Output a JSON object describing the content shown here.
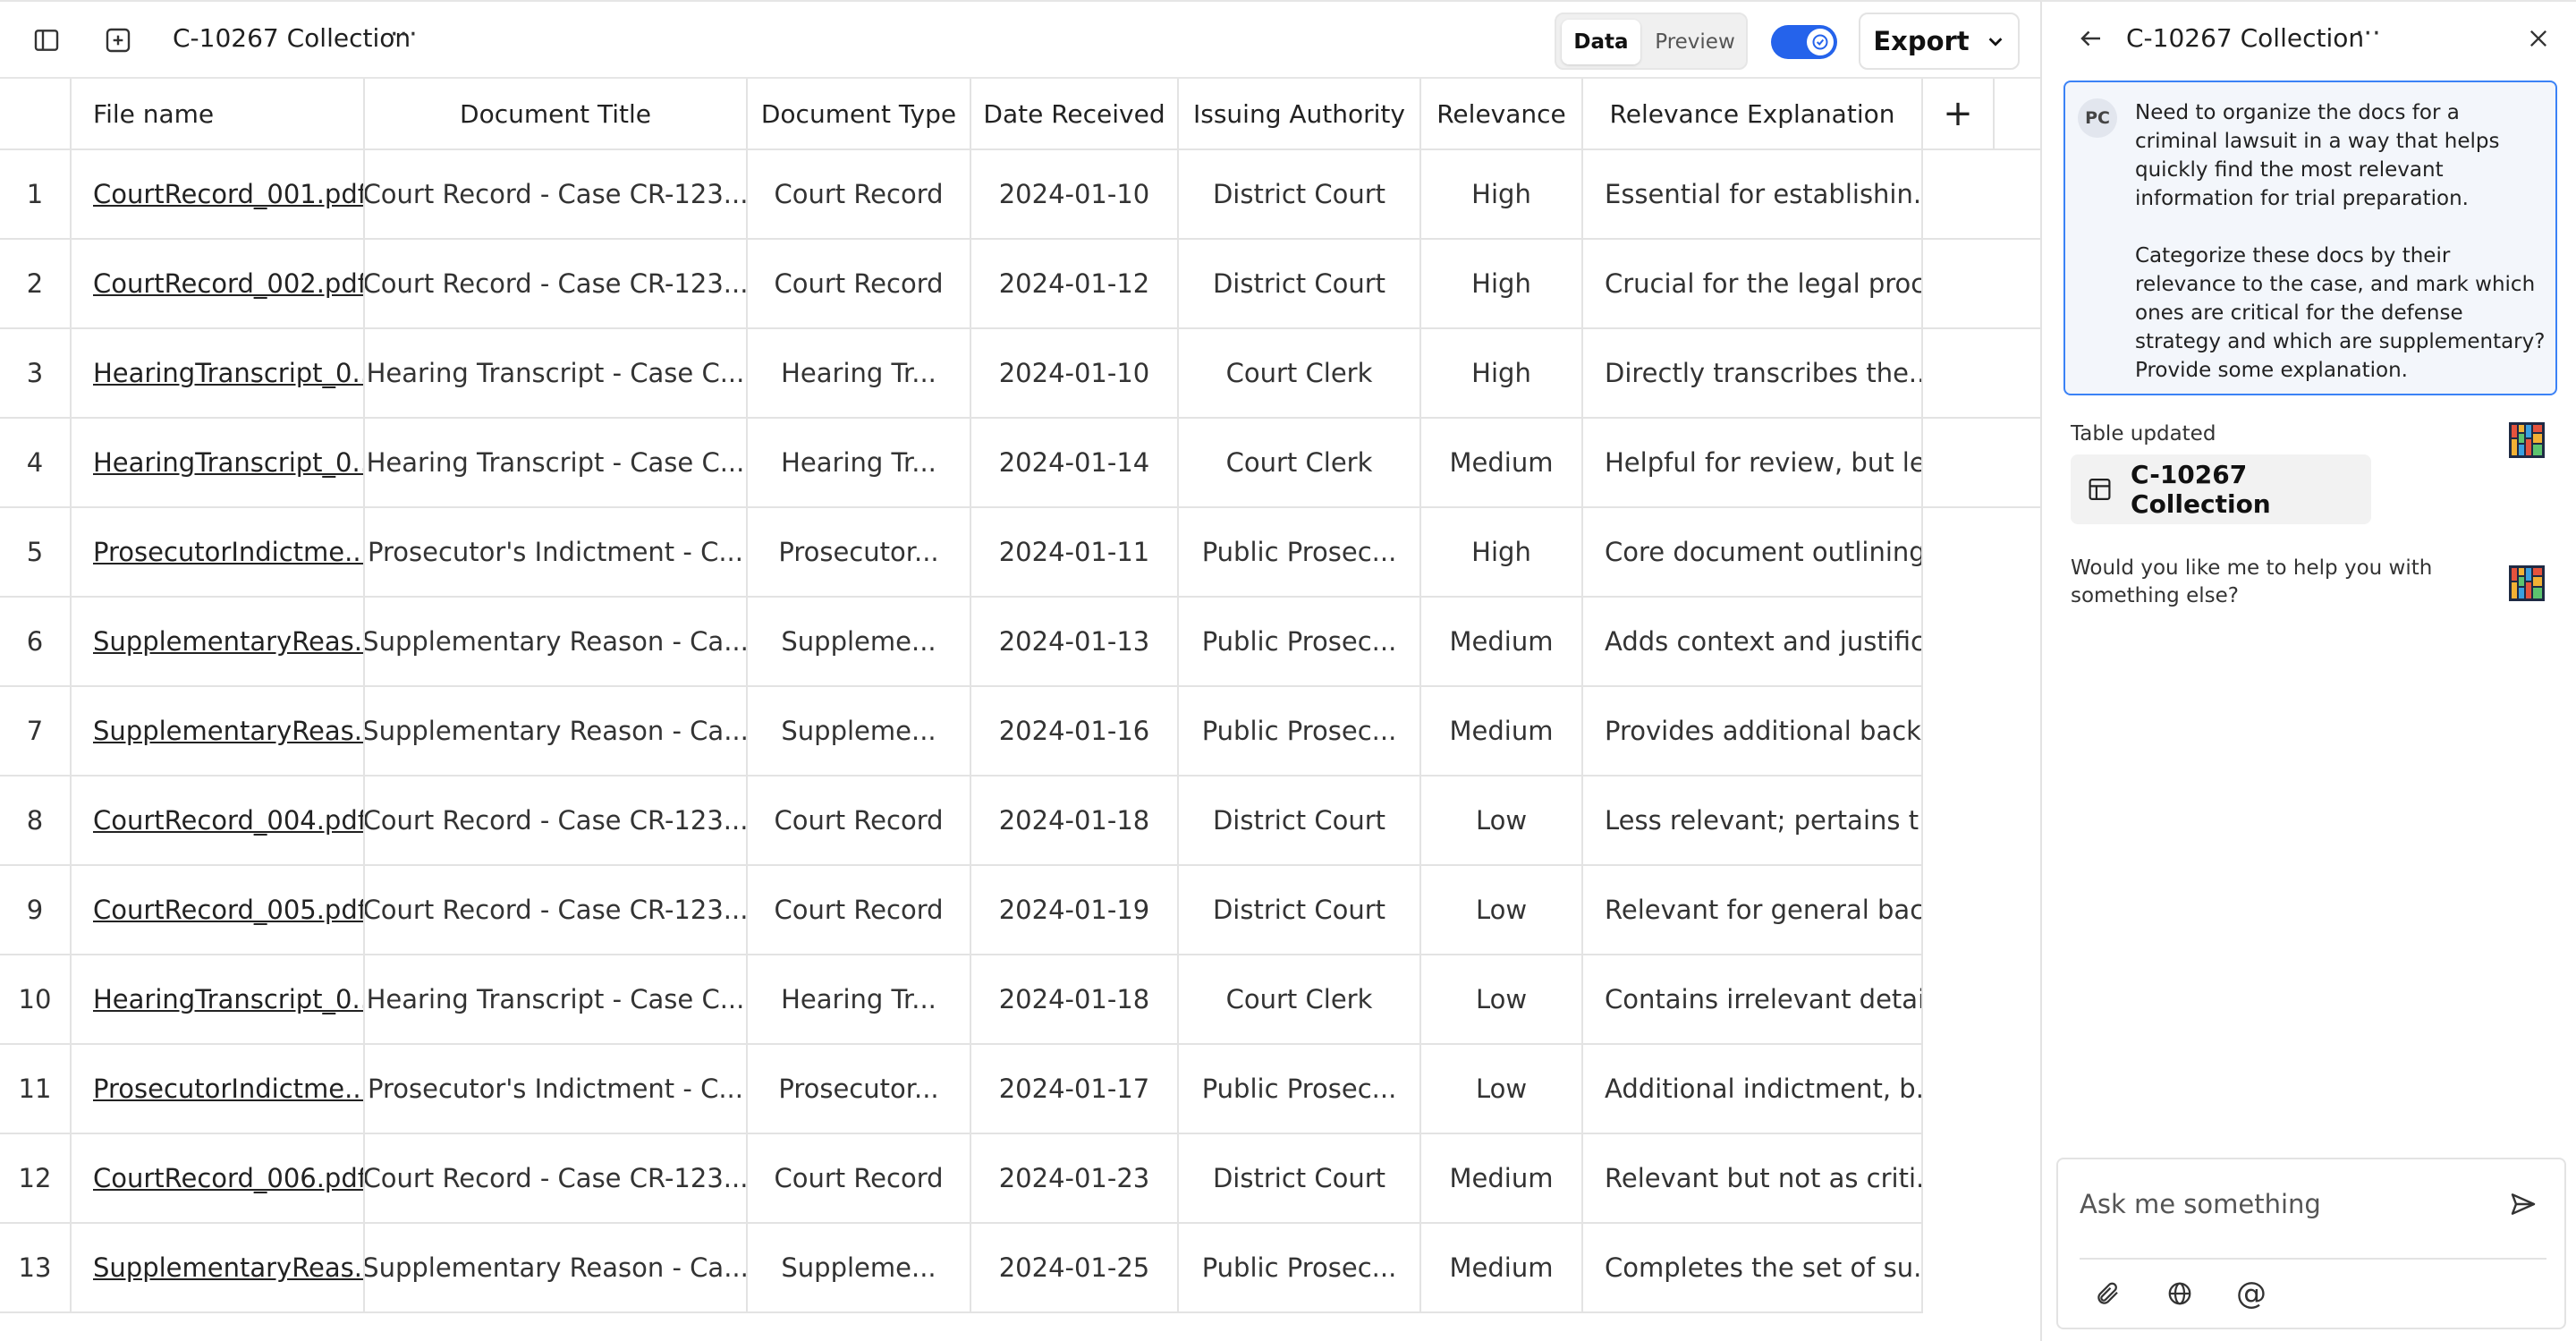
{
  "header": {
    "title": "C-10267 Collection",
    "more": "···",
    "view_toggle": {
      "data": "Data",
      "preview": "Preview"
    },
    "export_label": "Export"
  },
  "table": {
    "columns": [
      "File name",
      "Document Title",
      "Document Type",
      "Date Received",
      "Issuing Authority",
      "Relevance",
      "Relevance Explanation"
    ],
    "add_column": "+",
    "rows": [
      {
        "num": "1",
        "file": "CourtRecord_001.pdf",
        "title": "Court Record - Case CR-123...",
        "type": "Court Record",
        "date": "2024-01-10",
        "authority": "District Court",
        "relevance": "High",
        "explanation": "Essential for establishin..."
      },
      {
        "num": "2",
        "file": "CourtRecord_002.pdf",
        "title": "Court Record - Case CR-123...",
        "type": "Court Record",
        "date": "2024-01-12",
        "authority": "District Court",
        "relevance": "High",
        "explanation": "Crucial for the legal proc..."
      },
      {
        "num": "3",
        "file": "HearingTranscript_0...",
        "title": "Hearing Transcript - Case C...",
        "type": "Hearing Tr...",
        "date": "2024-01-10",
        "authority": "Court Clerk",
        "relevance": "High",
        "explanation": "Directly transcribes the..."
      },
      {
        "num": "4",
        "file": "HearingTranscript_0...",
        "title": "Hearing Transcript - Case C...",
        "type": "Hearing Tr...",
        "date": "2024-01-14",
        "authority": "Court Clerk",
        "relevance": "Medium",
        "explanation": "Helpful for review, but le..."
      },
      {
        "num": "5",
        "file": "ProsecutorIndictme...",
        "title": "Prosecutor's Indictment - C...",
        "type": "Prosecutor...",
        "date": "2024-01-11",
        "authority": "Public Prosec...",
        "relevance": "High",
        "explanation": "Core document outlining..."
      },
      {
        "num": "6",
        "file": "SupplementaryReas...",
        "title": "Supplementary Reason - Ca...",
        "type": "Suppleme...",
        "date": "2024-01-13",
        "authority": "Public Prosec...",
        "relevance": "Medium",
        "explanation": "Adds context and justific..."
      },
      {
        "num": "7",
        "file": "SupplementaryReas...",
        "title": "Supplementary Reason - Ca...",
        "type": "Suppleme...",
        "date": "2024-01-16",
        "authority": "Public Prosec...",
        "relevance": "Medium",
        "explanation": "Provides additional back..."
      },
      {
        "num": "8",
        "file": "CourtRecord_004.pdf",
        "title": "Court Record - Case CR-123...",
        "type": "Court Record",
        "date": "2024-01-18",
        "authority": "District Court",
        "relevance": "Low",
        "explanation": "Less relevant; pertains t..."
      },
      {
        "num": "9",
        "file": "CourtRecord_005.pdf",
        "title": "Court Record - Case CR-123...",
        "type": "Court Record",
        "date": "2024-01-19",
        "authority": "District Court",
        "relevance": "Low",
        "explanation": "Relevant for general bac..."
      },
      {
        "num": "10",
        "file": "HearingTranscript_0...",
        "title": "Hearing Transcript - Case C...",
        "type": "Hearing Tr...",
        "date": "2024-01-18",
        "authority": "Court Clerk",
        "relevance": "Low",
        "explanation": "Contains irrelevant detai..."
      },
      {
        "num": "11",
        "file": "ProsecutorIndictme...",
        "title": "Prosecutor's Indictment - C...",
        "type": "Prosecutor...",
        "date": "2024-01-17",
        "authority": "Public Prosec...",
        "relevance": "Low",
        "explanation": "Additional indictment, b..."
      },
      {
        "num": "12",
        "file": "CourtRecord_006.pdf",
        "title": "Court Record - Case CR-123...",
        "type": "Court Record",
        "date": "2024-01-23",
        "authority": "District Court",
        "relevance": "Medium",
        "explanation": "Relevant but not as criti..."
      },
      {
        "num": "13",
        "file": "SupplementaryReas...",
        "title": "Supplementary Reason - Ca...",
        "type": "Suppleme...",
        "date": "2024-01-25",
        "authority": "Public Prosec...",
        "relevance": "Medium",
        "explanation": "Completes the set of su..."
      }
    ]
  },
  "chat": {
    "title": "C-10267 Collection",
    "more": "···",
    "user_initials": "PC",
    "user_message": "Need to organize the docs for a criminal lawsuit in a way that helps quickly find the most relevant information for trial preparation.\n\nCategorize these docs by their relevance to the case, and mark which ones are critical for the defense strategy and which are supplementary? Provide some explanation.",
    "table_updated": "Table updated",
    "collection_chip": "C-10267 Collection",
    "followup": "Would you like me to help you with something else?",
    "input_placeholder": "Ask me something",
    "mention_symbol": "@"
  },
  "colors": {
    "accent": "#2563eb",
    "border": "#e3e3e3",
    "message_border": "#3b82f6"
  }
}
